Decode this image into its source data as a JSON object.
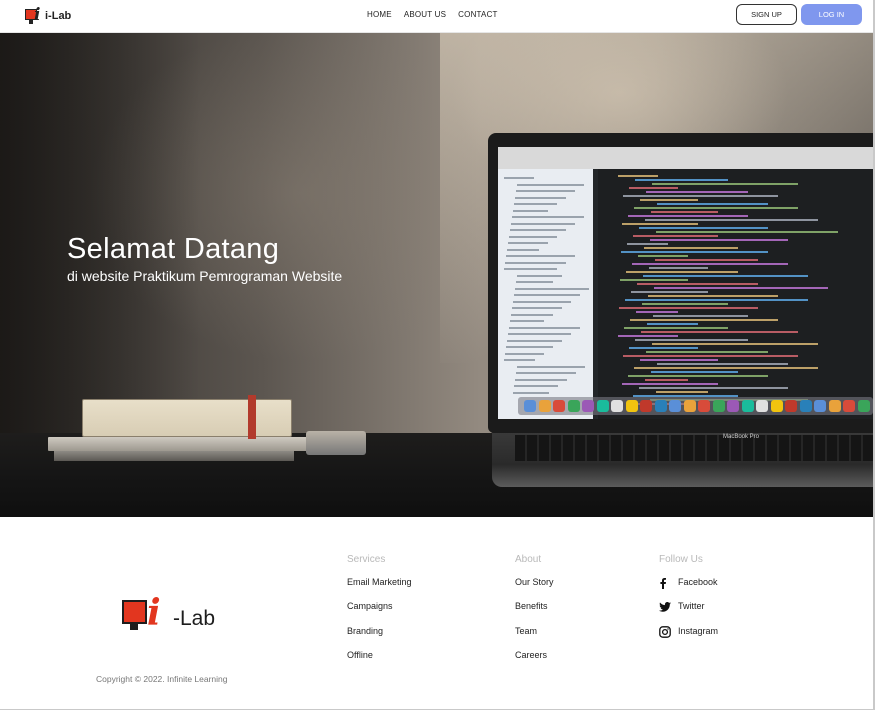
{
  "navbar": {
    "brand_text": "i-Lab",
    "links": [
      {
        "label": "HOME"
      },
      {
        "label": "ABOUT US"
      },
      {
        "label": "CONTACT"
      }
    ],
    "signup_label": "SIGN UP",
    "login_label": "LOG IN",
    "colors": {
      "login_button": "#7f97ee",
      "logo_red": "#e2361f"
    }
  },
  "hero": {
    "title": "Selamat Datang",
    "subtitle": "di website Praktikum Pemrograman  Website",
    "laptop_label": "MacBook Pro"
  },
  "footer": {
    "brand_text": "-Lab",
    "copyright": "Copyright © 2022. Infinite Learning",
    "services": {
      "heading": "Services",
      "items": [
        "Email Marketing",
        "Campaigns",
        "Branding",
        "Offline"
      ]
    },
    "about": {
      "heading": "About",
      "items": [
        "Our Story",
        "Benefits",
        "Team",
        "Careers"
      ]
    },
    "follow": {
      "heading": "Follow Us",
      "items": [
        {
          "label": "Facebook",
          "icon": "facebook-icon"
        },
        {
          "label": "Twitter",
          "icon": "twitter-icon"
        },
        {
          "label": "Instagram",
          "icon": "instagram-icon"
        }
      ]
    }
  }
}
